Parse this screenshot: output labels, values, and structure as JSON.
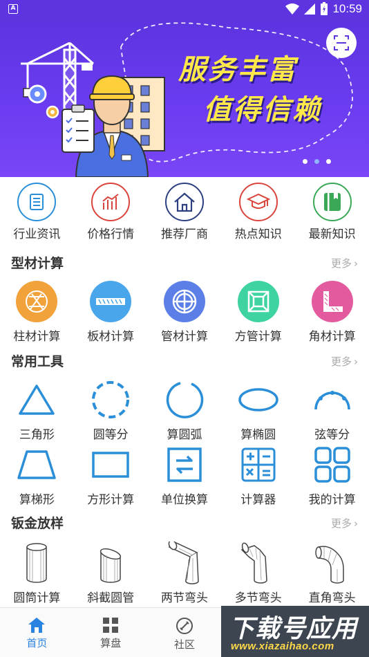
{
  "status_bar": {
    "time": "10:59",
    "notification_badge": "A"
  },
  "banner": {
    "headline_line1": "服务丰富",
    "headline_line2": "值得信赖",
    "headline_color": "#ffe94a",
    "background_color": "#6b3cf0",
    "page_count": 3,
    "active_page": 2
  },
  "quick_nav": [
    {
      "label": "行业资讯",
      "icon": "news-list-icon",
      "color": "#2a8fd8"
    },
    {
      "label": "价格行情",
      "icon": "price-chart-icon",
      "color": "#d9443c"
    },
    {
      "label": "推荐厂商",
      "icon": "house-icon",
      "color": "#2c3f80"
    },
    {
      "label": "热点知识",
      "icon": "graduation-cap-icon",
      "color": "#d9443c"
    },
    {
      "label": "最新知识",
      "icon": "book-icon",
      "color": "#3aa857"
    }
  ],
  "section_profile": {
    "title": "型材计算",
    "more": "更多"
  },
  "profile_items": [
    {
      "label": "柱材计算",
      "icon": "column-icon",
      "color": "#f2a23a"
    },
    {
      "label": "板材计算",
      "icon": "plate-icon",
      "color": "#4aa6ea"
    },
    {
      "label": "管材计算",
      "icon": "pipe-icon",
      "color": "#5b7fe6"
    },
    {
      "label": "方管计算",
      "icon": "square-tube-icon",
      "color": "#3fd3a2"
    },
    {
      "label": "角材计算",
      "icon": "angle-steel-icon",
      "color": "#e35a9e"
    }
  ],
  "section_tools": {
    "title": "常用工具",
    "more": "更多"
  },
  "tools_row1": [
    {
      "label": "三角形",
      "icon": "triangle-icon"
    },
    {
      "label": "圆等分",
      "icon": "dashed-circle-icon"
    },
    {
      "label": "算圆弧",
      "icon": "arc-icon"
    },
    {
      "label": "算椭圆",
      "icon": "ellipse-icon"
    },
    {
      "label": "弦等分",
      "icon": "chord-icon"
    }
  ],
  "tools_row2": [
    {
      "label": "算梯形",
      "icon": "trapezoid-icon"
    },
    {
      "label": "方形计算",
      "icon": "rectangle-icon"
    },
    {
      "label": "单位换算",
      "icon": "unit-convert-icon"
    },
    {
      "label": "计算器",
      "icon": "calculator-icon"
    },
    {
      "label": "我的计算",
      "icon": "my-calc-grid-icon"
    }
  ],
  "tool_color": "#2a8fd8",
  "section_sheet": {
    "title": "钣金放样",
    "more": "更多"
  },
  "sheet_items": [
    {
      "label": "圆筒计算",
      "icon": "cylinder-icon"
    },
    {
      "label": "斜截圆管",
      "icon": "oblique-pipe-icon"
    },
    {
      "label": "两节弯头",
      "icon": "two-section-elbow-icon"
    },
    {
      "label": "多节弯头",
      "icon": "multi-section-elbow-icon"
    },
    {
      "label": "直角弯头",
      "icon": "right-angle-elbow-icon"
    }
  ],
  "tabs": [
    {
      "label": "首页",
      "icon": "home-icon",
      "active": true
    },
    {
      "label": "算盘",
      "icon": "grid-icon",
      "active": false
    },
    {
      "label": "社区",
      "icon": "community-icon",
      "active": false
    },
    {
      "label": "",
      "icon": "",
      "active": false
    },
    {
      "label": "",
      "icon": "",
      "active": false
    }
  ],
  "watermark": {
    "title": "下载号应用",
    "url": "www.xiazaihao.com"
  }
}
